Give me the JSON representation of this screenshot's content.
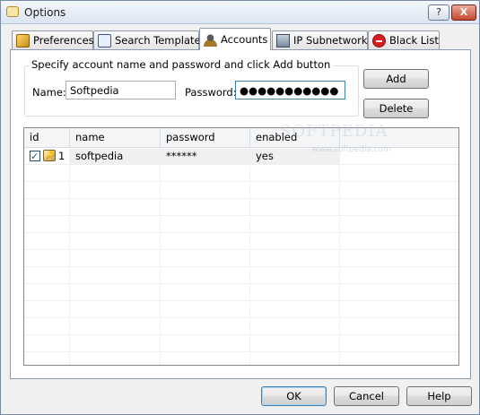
{
  "window": {
    "title": "Options",
    "help_label": "?",
    "close_label": "X"
  },
  "tabs": [
    {
      "label": "Preferences",
      "icon": "preferences-icon"
    },
    {
      "label": "Search Templates",
      "icon": "search-templates-icon"
    },
    {
      "label": "Accounts",
      "icon": "accounts-icon",
      "active": true
    },
    {
      "label": "IP Subnetworks",
      "icon": "network-icon"
    },
    {
      "label": "Black List",
      "icon": "blacklist-icon"
    }
  ],
  "accounts": {
    "group_label": "Specify account name and password and click Add button",
    "name_label": "Name:",
    "name_value": "Softpedia",
    "password_label": "Password:",
    "password_value": "●●●●●●●●●●●",
    "add_label": "Add",
    "delete_label": "Delete"
  },
  "grid": {
    "columns": [
      "id",
      "name",
      "password",
      "enabled"
    ],
    "rows": [
      {
        "id": "1",
        "name": "softpedia",
        "password": "******",
        "enabled": "yes",
        "checked": true
      }
    ]
  },
  "footer": {
    "ok_label": "OK",
    "cancel_label": "Cancel",
    "help_label": "Help"
  },
  "watermark": {
    "main": "SOFTPEDIA",
    "sub": "www.softpedia.com"
  }
}
